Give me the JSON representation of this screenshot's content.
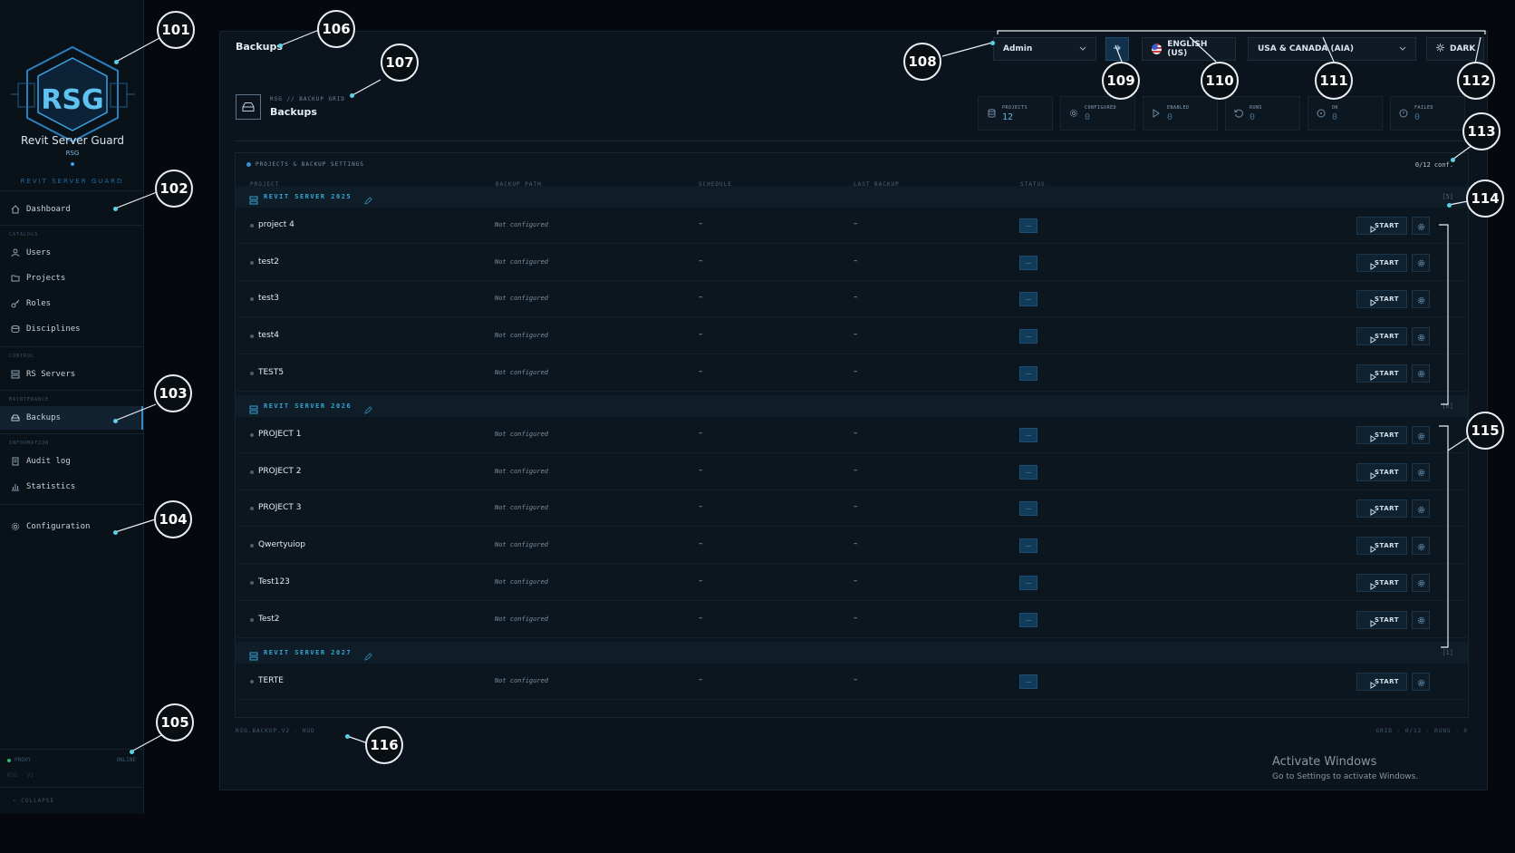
{
  "app": {
    "brand_name": "Revit Server Guard",
    "brand_mark": "RSG",
    "brand_label": "REVIT SERVER GUARD"
  },
  "sidebar": {
    "items": [
      {
        "label": "Dashboard",
        "icon": "home-icon"
      },
      {
        "section": "CATALOGS"
      },
      {
        "label": "Users",
        "icon": "users-icon"
      },
      {
        "label": "Projects",
        "icon": "folder-icon"
      },
      {
        "label": "Roles",
        "icon": "key-icon"
      },
      {
        "label": "Disciplines",
        "icon": "layers-icon"
      },
      {
        "section": "CONTROL"
      },
      {
        "label": "RS Servers",
        "icon": "server-icon"
      },
      {
        "section": "MAINTENANCE"
      },
      {
        "label": "Backups",
        "icon": "backup-icon",
        "active": true
      },
      {
        "section": "INFORMATION"
      },
      {
        "label": "Audit log",
        "icon": "log-icon"
      },
      {
        "label": "Statistics",
        "icon": "chart-icon"
      },
      {
        "label": "Configuration",
        "icon": "gear-icon"
      }
    ],
    "proxy_label": "PROXY",
    "proxy_status": "ONLINE",
    "proxy_sub": "RSG · V2",
    "collapse_label": "COLLAPSE"
  },
  "topbar": {
    "page_title": "Backups",
    "role": "Admin",
    "language": "ENGLISH (US)",
    "region": "USA & CANADA (AIA)",
    "theme": "DARK"
  },
  "header": {
    "breadcrumb": "RSG // BACKUP GRID",
    "title": "Backups"
  },
  "stats": [
    {
      "label": "PROJECTS",
      "value": "12",
      "icon": "database-icon"
    },
    {
      "label": "CONFIGURED",
      "value": "0",
      "icon": "gear-icon"
    },
    {
      "label": "ENABLED",
      "value": "0",
      "icon": "play-icon"
    },
    {
      "label": "RUNS",
      "value": "0",
      "icon": "history-icon"
    },
    {
      "label": "OK",
      "value": "0",
      "icon": "check-circle-icon"
    },
    {
      "label": "FAILED",
      "value": "0",
      "icon": "alert-circle-icon"
    }
  ],
  "grid": {
    "title": "PROJECTS & BACKUP SETTINGS",
    "conf_count": "0/12 conf.",
    "columns": [
      "PROJECT",
      "BACKUP PATH",
      "SCHEDULE",
      "LAST BACKUP",
      "STATUS"
    ],
    "start_label": "START",
    "groups": [
      {
        "name": "REVIT SERVER 2025",
        "count": "[5]",
        "rows": [
          {
            "project": "project 4",
            "path": "Not configured",
            "schedule": "–",
            "last": "–",
            "status": "—"
          },
          {
            "project": "test2",
            "path": "Not configured",
            "schedule": "–",
            "last": "–",
            "status": "—"
          },
          {
            "project": "test3",
            "path": "Not configured",
            "schedule": "–",
            "last": "–",
            "status": "—"
          },
          {
            "project": "test4",
            "path": "Not configured",
            "schedule": "–",
            "last": "–",
            "status": "—"
          },
          {
            "project": "TEST5",
            "path": "Not configured",
            "schedule": "–",
            "last": "–",
            "status": "—"
          }
        ]
      },
      {
        "name": "REVIT SERVER 2026",
        "count": "[6]",
        "rows": [
          {
            "project": "PROJECT 1",
            "path": "Not configured",
            "schedule": "–",
            "last": "–",
            "status": "—"
          },
          {
            "project": "PROJECT 2",
            "path": "Not configured",
            "schedule": "–",
            "last": "–",
            "status": "—"
          },
          {
            "project": "PROJECT 3",
            "path": "Not configured",
            "schedule": "–",
            "last": "–",
            "status": "—"
          },
          {
            "project": "Qwertyuiop",
            "path": "Not configured",
            "schedule": "–",
            "last": "–",
            "status": "—"
          },
          {
            "project": "Test123",
            "path": "Not configured",
            "schedule": "–",
            "last": "–",
            "status": "—"
          },
          {
            "project": "Test2",
            "path": "Not configured",
            "schedule": "–",
            "last": "–",
            "status": "—"
          }
        ]
      },
      {
        "name": "REVIT SERVER 2027",
        "count": "[1]",
        "rows": [
          {
            "project": "TERTE",
            "path": "Not configured",
            "schedule": "–",
            "last": "–",
            "status": "—"
          }
        ]
      }
    ]
  },
  "footer": {
    "left": "RSG.BACKUP.V2 · HUD",
    "right": "GRID · 0/12 · RUNS · 0"
  },
  "watermark": {
    "title": "Activate Windows",
    "subtitle": "Go to Settings to activate Windows."
  },
  "callouts": [
    "101",
    "102",
    "103",
    "104",
    "105",
    "106",
    "107",
    "108",
    "109",
    "110",
    "111",
    "112",
    "113",
    "114",
    "115",
    "116"
  ],
  "colors": {
    "accent": "#35a8d8",
    "status_box": "#123a59",
    "background": "#05090d"
  }
}
